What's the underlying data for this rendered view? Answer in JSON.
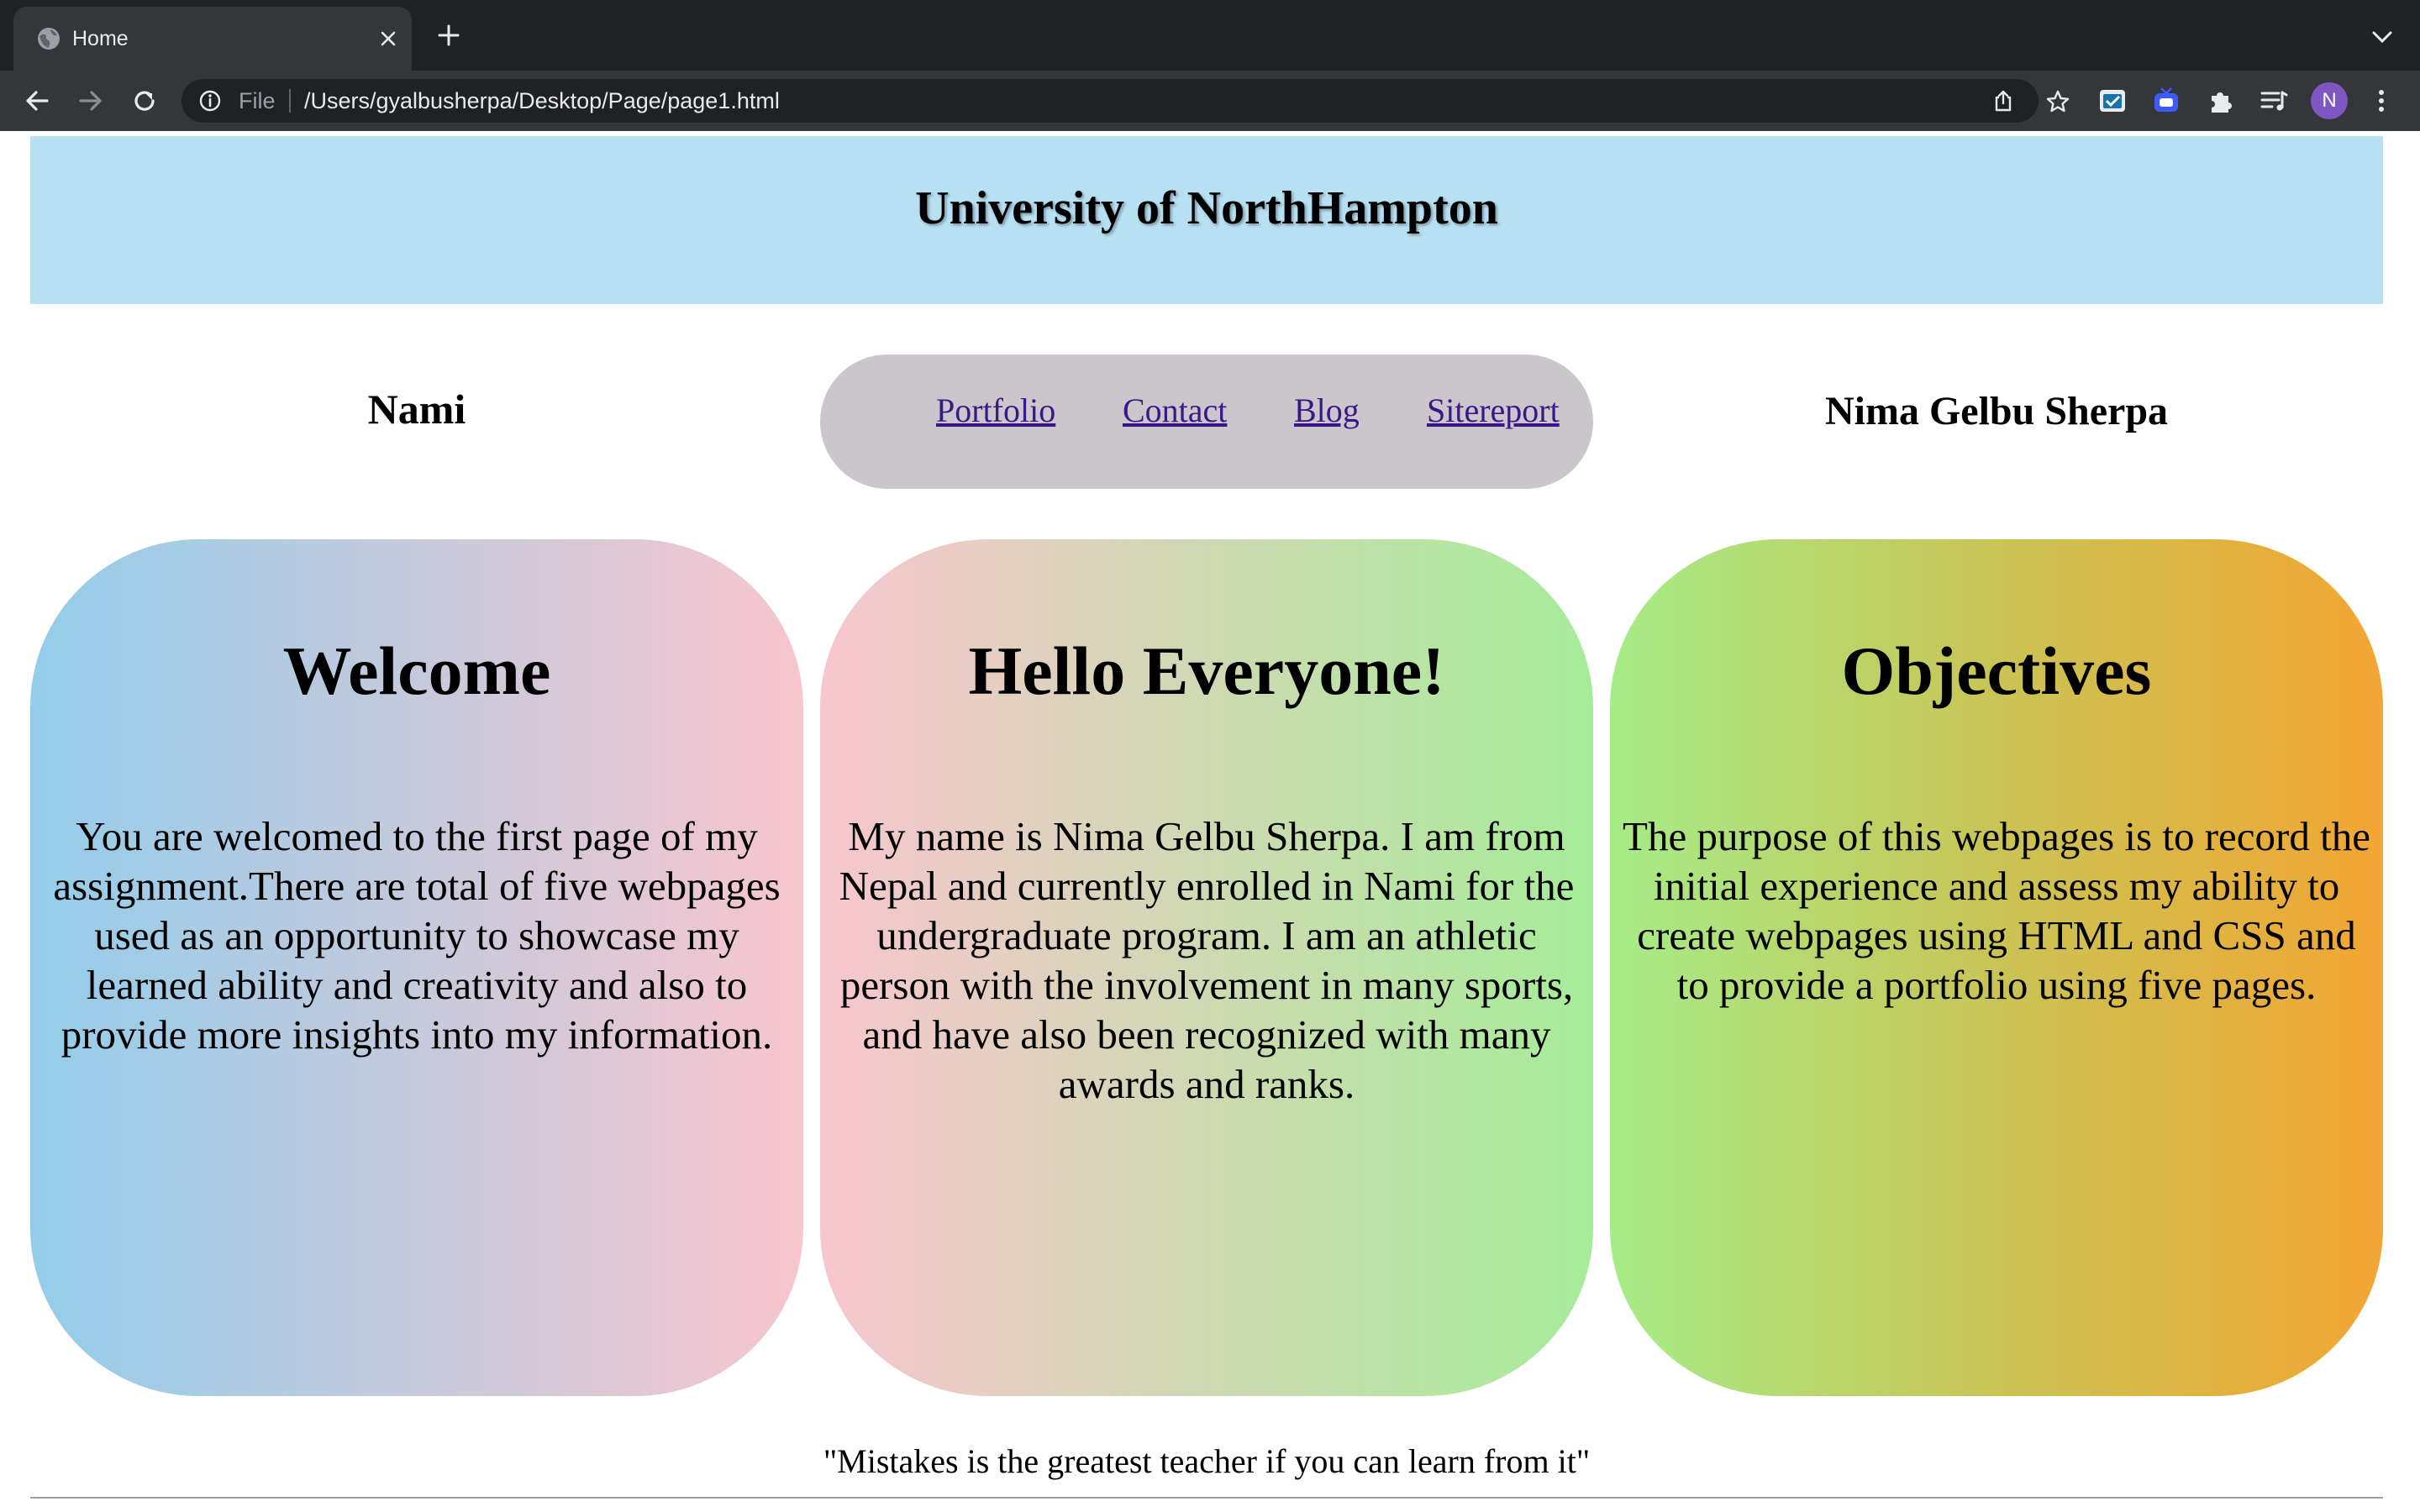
{
  "browser": {
    "tab": {
      "title": "Home",
      "favicon": "globe-icon",
      "close_icon": "close-icon"
    },
    "new_tab_icon": "plus-icon",
    "tab_search_icon": "chevron-down-icon",
    "nav": {
      "back_icon": "arrow-left-icon",
      "forward_icon": "arrow-right-icon",
      "reload_icon": "reload-icon"
    },
    "omnibox": {
      "info_icon": "info-icon",
      "scheme": "File",
      "url": "/Users/gyalbusherpa/Desktop/Page/page1.html",
      "share_icon": "share-icon",
      "bookmark_icon": "star-icon"
    },
    "extensions": [
      "screenshot-extension-icon",
      "tv-extension-icon",
      "puzzle-icon",
      "reading-list-icon"
    ],
    "profile_initial": "N",
    "colors": {
      "frame": "#202124",
      "toolbar": "#35363a",
      "avatar": "#7e57c2"
    }
  },
  "page": {
    "header": {
      "title": "University of NorthHampton",
      "bg": "#b8e0f3"
    },
    "brand_left": "Nami",
    "brand_right": "Nima Gelbu Sherpa",
    "nav_links": [
      "Portfolio",
      "Contact",
      "Blog",
      "Sitereport"
    ],
    "cards": [
      {
        "heading": "Welcome",
        "body": "You are welcomed to the first page of my assignment.There are total of five webpages used as an opportunity to showcase my learned ability and creativity and also to provide more insights into my information."
      },
      {
        "heading": "Hello Everyone!",
        "body": "My name is Nima Gelbu Sherpa. I am from Nepal and currently enrolled in Nami for the undergraduate program. I am an athletic person with the involvement in many sports, and have also been recognized with many awards and ranks."
      },
      {
        "heading": "Objectives",
        "body": "The purpose of this webpages is to record the initial experience and assess my ability to create webpages using HTML and CSS and to provide a portfolio using five pages."
      }
    ],
    "quote": "\"Mistakes is the greatest teacher if you can learn from it\""
  }
}
